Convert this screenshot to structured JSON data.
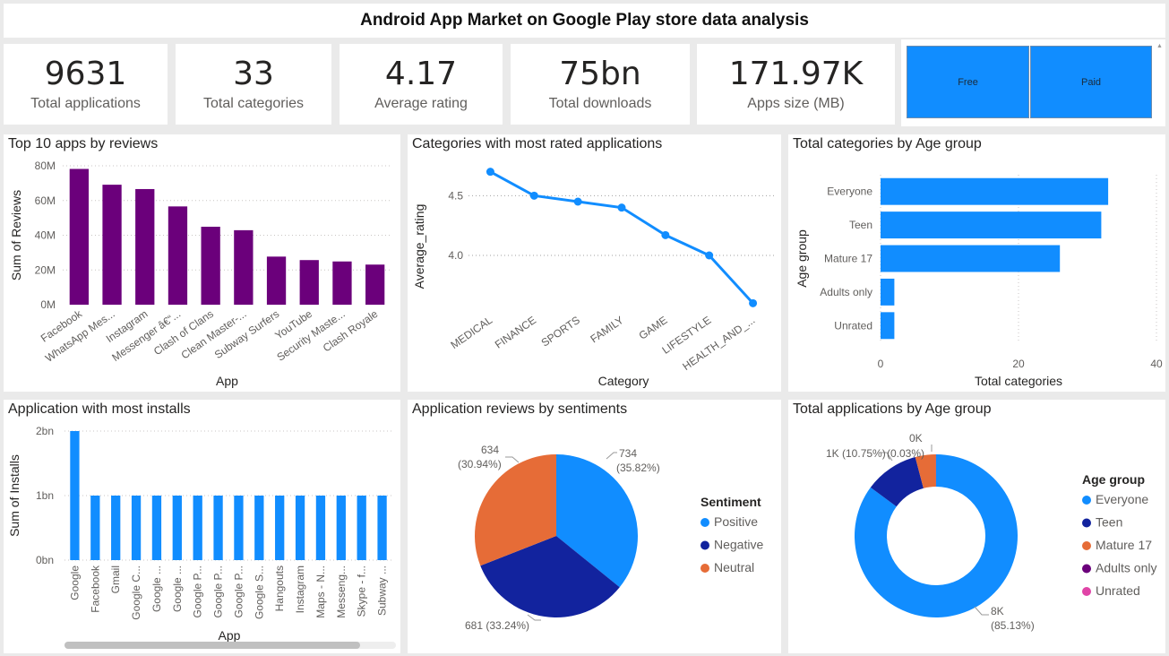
{
  "header": {
    "title": "Android App Market on Google Play store data analysis"
  },
  "kpis": [
    {
      "value": "9631",
      "label": "Total applications"
    },
    {
      "value": "33",
      "label": "Total categories"
    },
    {
      "value": "4.17",
      "label": "Average rating"
    },
    {
      "value": "75bn",
      "label": "Total downloads"
    },
    {
      "value": "171.97K",
      "label": "Apps size (MB)"
    }
  ],
  "slicer": {
    "options": [
      "Free",
      "Paid"
    ],
    "scroll_glyph": "▲",
    "accent": "#118dff"
  },
  "colors": {
    "purple": "#6b007b",
    "blue": "#118dff",
    "navy": "#12239e",
    "orange": "#e66c37",
    "darkpurple": "#6b007b",
    "pink": "#e044a7"
  },
  "chart_data": [
    {
      "id": "reviews",
      "type": "bar",
      "title": "Top 10 apps by reviews",
      "xlabel": "App",
      "ylabel": "Sum of Reviews",
      "categories": [
        "Facebook",
        "WhatsApp Mes...",
        "Instagram",
        "Messenger â€“...",
        "Clash of Clans",
        "Clean Master-...",
        "Subway Surfers",
        "YouTube",
        "Security Maste...",
        "Clash Royale"
      ],
      "values": [
        78.2,
        69.1,
        66.6,
        56.6,
        44.9,
        42.9,
        27.7,
        25.7,
        24.9,
        23.1
      ],
      "yticks": [
        "0M",
        "20M",
        "40M",
        "60M",
        "80M"
      ],
      "ylim": [
        0,
        80
      ],
      "grid": true,
      "color": "#6b007b"
    },
    {
      "id": "ratings",
      "type": "line",
      "title": "Categories with most rated applications",
      "xlabel": "Category",
      "ylabel": "Average_rating",
      "categories": [
        "MEDICAL",
        "FINANCE",
        "SPORTS",
        "FAMILY",
        "GAME",
        "LIFESTYLE",
        "HEALTH_AND_..."
      ],
      "values": [
        4.7,
        4.5,
        4.45,
        4.4,
        4.17,
        4.0,
        3.6
      ],
      "yticks": [
        "4.0",
        "4.5"
      ],
      "ylim": [
        3.55,
        4.75
      ],
      "grid": true,
      "color": "#118dff"
    },
    {
      "id": "agecats",
      "type": "bar",
      "orientation": "horizontal",
      "title": "Total categories by Age group",
      "xlabel": "Total categories",
      "ylabel": "Age group",
      "categories": [
        "Everyone",
        "Teen",
        "Mature 17",
        "Adults only",
        "Unrated"
      ],
      "values": [
        33,
        32,
        26,
        2,
        2
      ],
      "xticks": [
        "0",
        "20",
        "40"
      ],
      "xlim": [
        0,
        40
      ],
      "grid": true,
      "color": "#118dff"
    },
    {
      "id": "installs",
      "type": "bar",
      "title": "Application with most installs",
      "xlabel": "App",
      "ylabel": "Sum of Installs",
      "categories": [
        "Google",
        "Facebook",
        "Gmail",
        "Google C...",
        "Google ...",
        "Google ...",
        "Google P...",
        "Google P...",
        "Google P...",
        "Google S...",
        "Hangouts",
        "Instagram",
        "Maps - N...",
        "Messeng...",
        "Skype - f...",
        "Subway ..."
      ],
      "values": [
        2,
        1,
        1,
        1,
        1,
        1,
        1,
        1,
        1,
        1,
        1,
        1,
        1,
        1,
        1,
        1
      ],
      "yticks": [
        "0bn",
        "1bn",
        "2bn"
      ],
      "ylim": [
        0,
        2
      ],
      "grid": true,
      "color": "#118dff"
    },
    {
      "id": "sentiment",
      "type": "pie",
      "title": "Application reviews by sentiments",
      "legend_title": "Sentiment",
      "legend_position": "right",
      "labels": [
        "Positive",
        "Negative",
        "Neutral"
      ],
      "values": [
        734,
        681,
        634
      ],
      "value_labels": [
        "734",
        "681 (33.24%)",
        "634"
      ],
      "percent_labels": [
        "(35.82%)",
        "",
        "(30.94%)"
      ],
      "colors": [
        "#118dff",
        "#12239e",
        "#e66c37"
      ]
    },
    {
      "id": "agedonut",
      "type": "pie",
      "donut": true,
      "title": "Total applications by Age group",
      "legend_title": "Age group",
      "legend_position": "right",
      "labels": [
        "Everyone",
        "Teen",
        "Mature 17",
        "Adults only",
        "Unrated"
      ],
      "values": [
        85.13,
        10.75,
        4.09,
        0.03,
        0.0
      ],
      "value_labels": [
        "8K",
        "1K (10.75%)",
        "0K"
      ],
      "percent_labels": [
        "(85.13%)",
        "",
        "(0.03%)"
      ],
      "colors": [
        "#118dff",
        "#12239e",
        "#e66c37",
        "#6b007b",
        "#e044a7"
      ]
    }
  ]
}
